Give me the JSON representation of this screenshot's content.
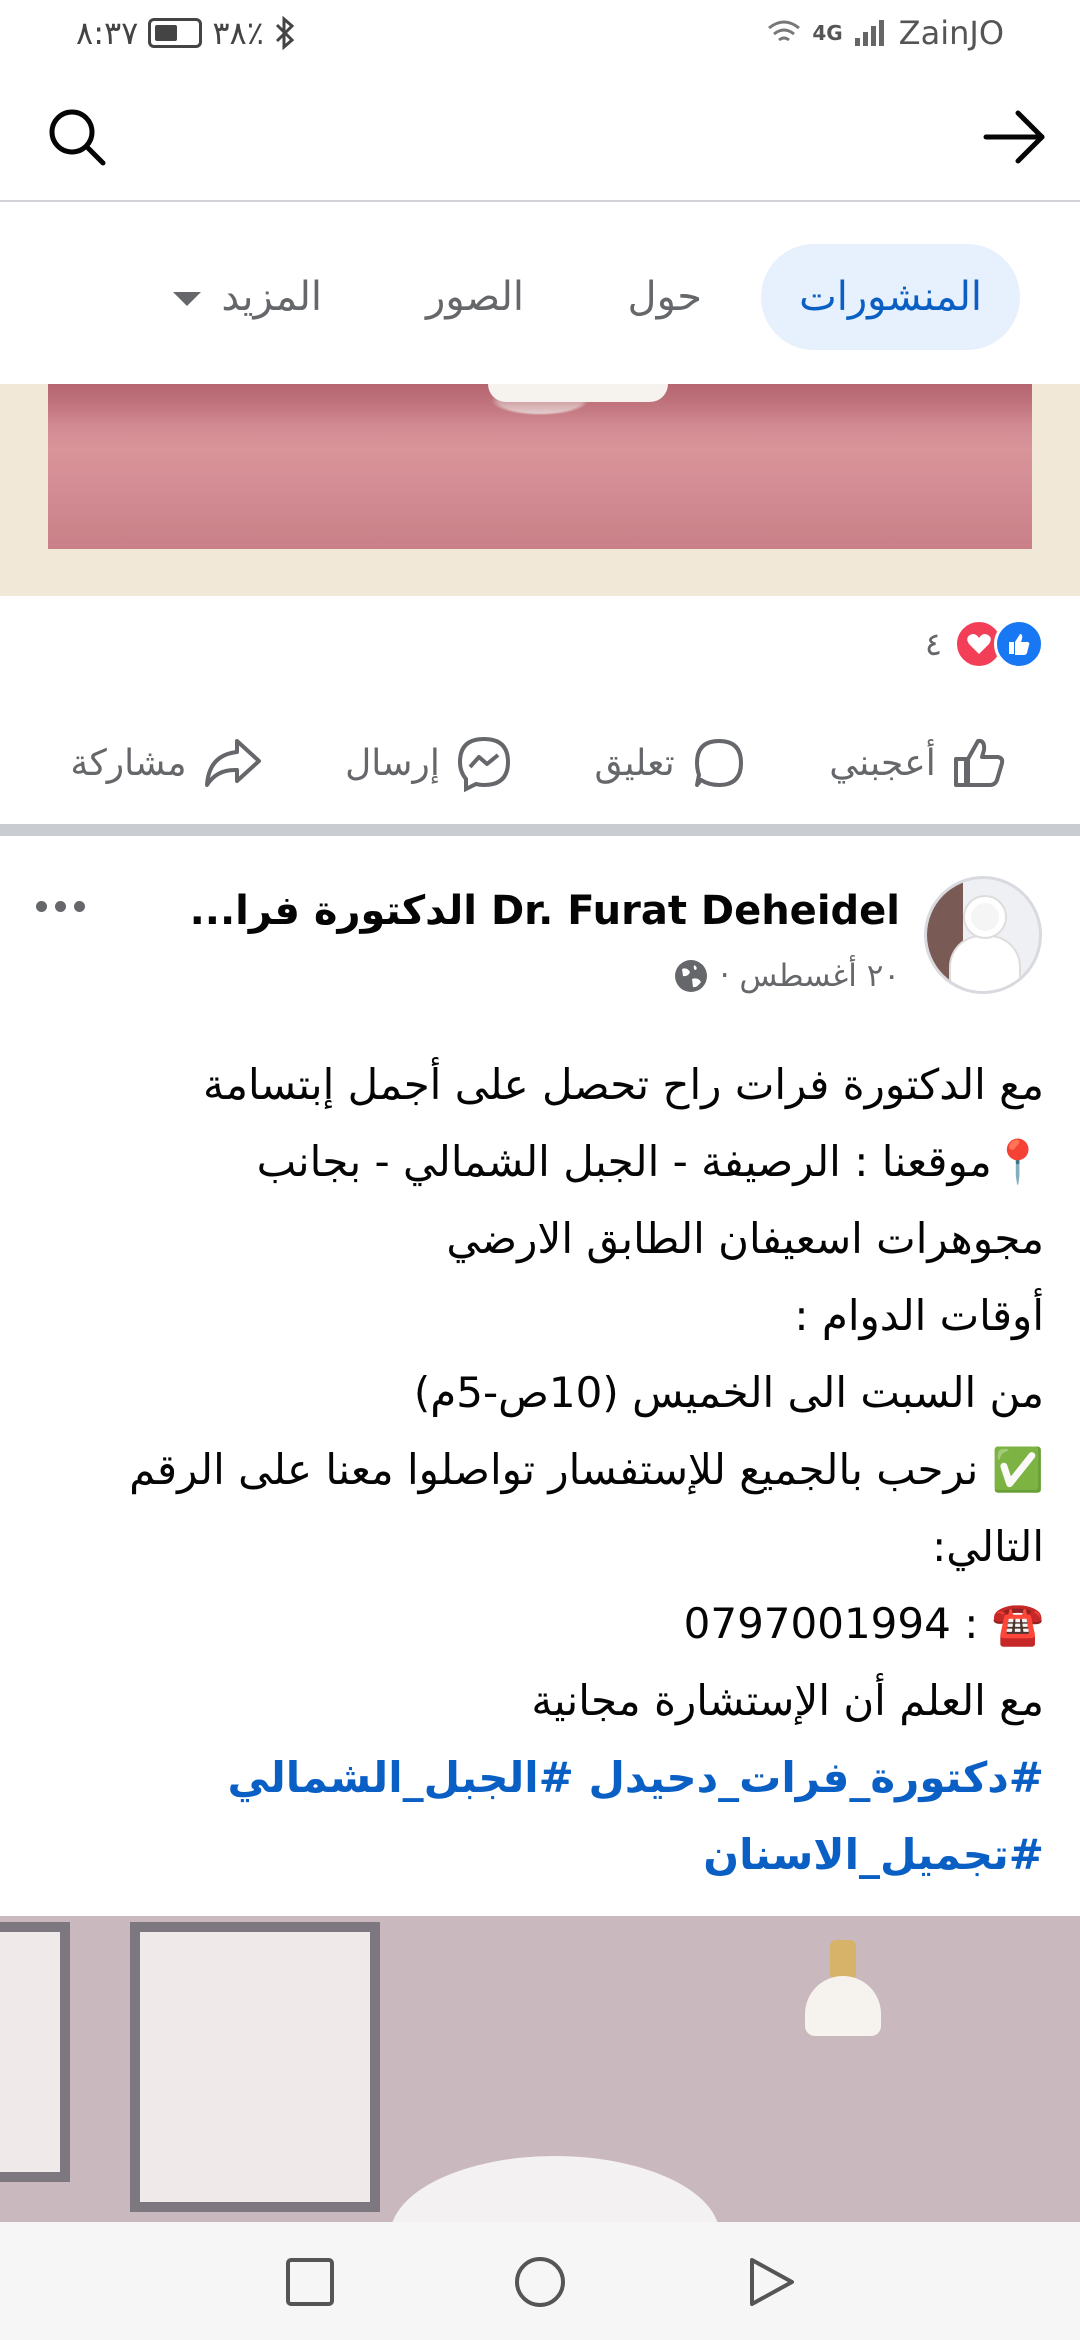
{
  "status_bar": {
    "time": "٨:٣٧",
    "battery": "٣٨٪",
    "carrier": "ZainJO",
    "network": "4G"
  },
  "tabs": [
    {
      "label": "المنشورات",
      "active": true
    },
    {
      "label": "حول",
      "active": false
    },
    {
      "label": "الصور",
      "active": false
    },
    {
      "label": "المزيد",
      "active": false
    }
  ],
  "reactions": {
    "count": "٤",
    "icons": [
      "like-icon",
      "love-icon"
    ]
  },
  "actions": {
    "like": "أعجبني",
    "comment": "تعليق",
    "send": "إرسال",
    "share": "مشاركة"
  },
  "post": {
    "author": "Dr. Furat Deheidel الدكتورة فرا...",
    "date": "٢٠ أغسطس ·",
    "privacy_icon": "globe-icon",
    "lines": [
      "مع الدكتورة فرات راح تحصل على أجمل إبتسامة",
      "📍موقعنا : الرصيفة - الجبل الشمالي - بجانب",
      "مجوهرات اسعيفان الطابق الارضي",
      "أوقات الدوام :",
      "من السبت الى الخميس (10ص-5م)",
      "✅ نرحب بالجميع للإستفسار تواصلوا معنا على الرقم",
      "التالي:",
      "☎️ : 0797001994",
      "مع العلم أن الإستشارة مجانية"
    ],
    "hashtags": [
      "#دكتورة_فرات_دحيدل  #الجبل_الشمالي",
      "#تجميل_الاسنان"
    ]
  },
  "colors": {
    "accent": "#0a5fc4",
    "tab_active_bg": "#e7f0fd",
    "like_blue": "#1877f2",
    "love_red": "#f33e58",
    "secondary_text": "#65676b"
  }
}
